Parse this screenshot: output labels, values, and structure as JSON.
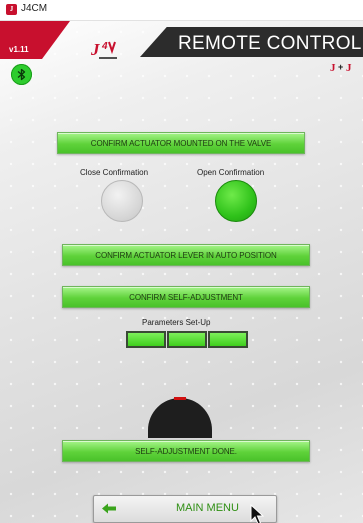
{
  "window": {
    "title": "J4CM",
    "icon_text": "J"
  },
  "header": {
    "version": "v1.11",
    "title": "REMOTE CONTROL",
    "brand_logo": "J4CM",
    "jj_logo": "J+J"
  },
  "bluetooth": {
    "icon": "bluetooth-icon",
    "color": "#2ecc2e"
  },
  "steps": {
    "confirm_mounted": "CONFIRM ACTUATOR MOUNTED ON THE VALVE",
    "close_confirmation": "Close Confirmation",
    "open_confirmation": "Open Confirmation",
    "confirm_lever": "CONFIRM ACTUATOR LEVER IN AUTO POSITION",
    "confirm_self_adjustment": "CONFIRM SELF-ADJUSTMENT",
    "parameters_label": "Parameters Set-Up",
    "self_adjustment_done": "SELF-ADJUSTMENT DONE."
  },
  "indicators": {
    "close_state": "off",
    "open_state": "on",
    "parameters_progress": 1.0
  },
  "navigation": {
    "main_menu": "MAIN MENU",
    "back_icon": "arrow-left-icon"
  },
  "colors": {
    "accent_green": "#5fd23a",
    "brand_red": "#c8102e",
    "header_dark": "#2c2c2c"
  }
}
